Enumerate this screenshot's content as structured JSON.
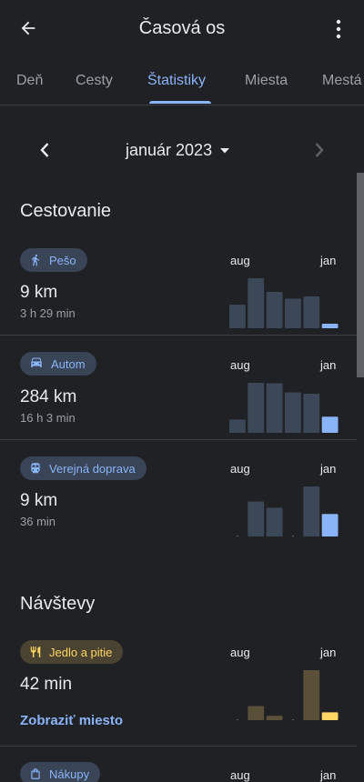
{
  "appbar": {
    "title": "Časová os",
    "back_icon": "arrow-back-icon",
    "more_icon": "more-vert-icon"
  },
  "tabs": [
    {
      "label": "Deň",
      "active": false
    },
    {
      "label": "Cesty",
      "active": false
    },
    {
      "label": "Štatistiky",
      "active": true
    },
    {
      "label": "Miesta",
      "active": false
    },
    {
      "label": "Mestá",
      "active": false
    }
  ],
  "month_nav": {
    "month": "január 2023",
    "next_enabled": false
  },
  "colors": {
    "bar_past_blue": "#3c4858",
    "bar_current_blue": "#8ab4f8",
    "bar_past_food": "#5a4f38",
    "bar_current_food": "#fdd663"
  },
  "travel": {
    "title": "Cestovanie",
    "items": [
      {
        "chip": "Pešo",
        "icon": "walk-icon",
        "value": "9 km",
        "sub": "3 h 29 min",
        "chart": {
          "start": "aug",
          "end": "jan",
          "values": [
            5.2,
            11,
            8,
            6.5,
            7,
            1
          ]
        }
      },
      {
        "chip": "Autom",
        "icon": "car-icon",
        "value": "284 km",
        "sub": "16 h 3 min",
        "chart": {
          "start": "aug",
          "end": "jan",
          "values": [
            28,
            105,
            104,
            85,
            82,
            34
          ]
        }
      },
      {
        "chip": "Verejná doprava",
        "icon": "train-icon",
        "value": "9 km",
        "sub": "36 min",
        "chart": {
          "start": "aug",
          "end": "jan",
          "values": [
            0,
            14,
            11.5,
            0,
            20,
            9
          ]
        }
      }
    ]
  },
  "visits": {
    "title": "Návštevy",
    "items": [
      {
        "chip": "Jedlo a pitie",
        "icon": "restaurant-icon",
        "value": "42 min",
        "link": "Zobraziť miesto",
        "chart": {
          "start": "aug",
          "end": "jan",
          "values": [
            0,
            16,
            5,
            0,
            57,
            9
          ]
        }
      },
      {
        "chip": "Nákupy",
        "icon": "shopping-bag-icon",
        "chart": {
          "start": "aug",
          "end": "jan"
        }
      }
    ]
  }
}
